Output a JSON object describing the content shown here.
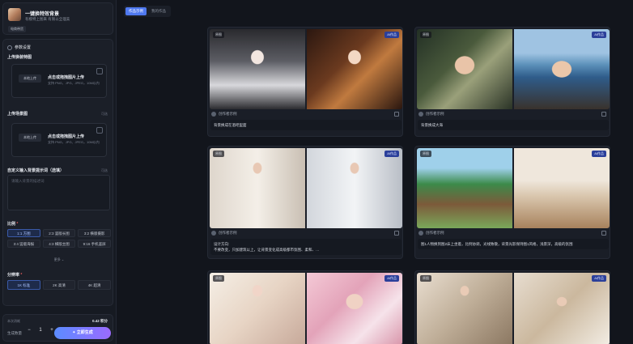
{
  "app": {
    "title": "一键换特效背景",
    "desc": "有模特上图来 有限以全理美",
    "tag": "电商带货"
  },
  "settings": {
    "section_title": "参数设置",
    "upload1": {
      "label": "上传换装特图",
      "local_btn": "本地上传",
      "title": "点击或拖拽图片上传",
      "hint": "支持 PNG、JPG、JPEG，10M以内"
    },
    "upload2": {
      "label": "上传场景图",
      "note": "可选",
      "local_btn": "本地上传",
      "title": "点击或拖拽图片上传",
      "hint": "支持 PNG、JPG、JPEG，10M以内"
    },
    "custom_prompt": {
      "label": "自定义输入背景提示词（选填）",
      "note": "可选",
      "placeholder": "请输入背景的描述词"
    },
    "ratio": {
      "label": "比例",
      "options": [
        "1:1 方图",
        "2:3 竖版长图",
        "3:2 横版摄影",
        "3:4 竖版海报",
        "4:3 横版主图",
        "9:16 手机竖屏"
      ],
      "more": "更多"
    },
    "resolution": {
      "label": "分辨率",
      "options": [
        "1K 标准",
        "2K 高清",
        "4K 超清"
      ]
    }
  },
  "generate": {
    "cost_label": "本次消耗",
    "cost_value": "0.42 积分",
    "qty_label": "生成数量",
    "qty_minus": "−",
    "qty_value": "1",
    "qty_plus": "+",
    "button": "立即生成"
  },
  "tabs": [
    "作品示例",
    "我的作品"
  ],
  "works": [
    {
      "orig_badge": "原图",
      "ai_badge": "AI作品",
      "author": "创作者示例",
      "prompt": "背景换成在酒吧里面"
    },
    {
      "orig_badge": "原图",
      "ai_badge": "AI作品",
      "author": "创作者示例",
      "prompt": "背景换成大海"
    },
    {
      "orig_badge": "原图",
      "ai_badge": "AI作品",
      "author": "创作者示例",
      "prompt": "设计方向:\n不要改变，只加建筑以上，让背景变化成高级都市氛围、柔和、…"
    },
    {
      "orig_badge": "原图",
      "ai_badge": "AI作品",
      "author": "创作者示例",
      "prompt": "图1人物换到图2床上坐着，比例协调，光线致敬，背景光影保持图1风格，浅景深，高级的氛围"
    },
    {
      "orig_badge": "原图",
      "ai_badge": "AI作品",
      "author": "",
      "prompt": ""
    },
    {
      "orig_badge": "原图",
      "ai_badge": "AI作品",
      "author": "",
      "prompt": ""
    }
  ]
}
